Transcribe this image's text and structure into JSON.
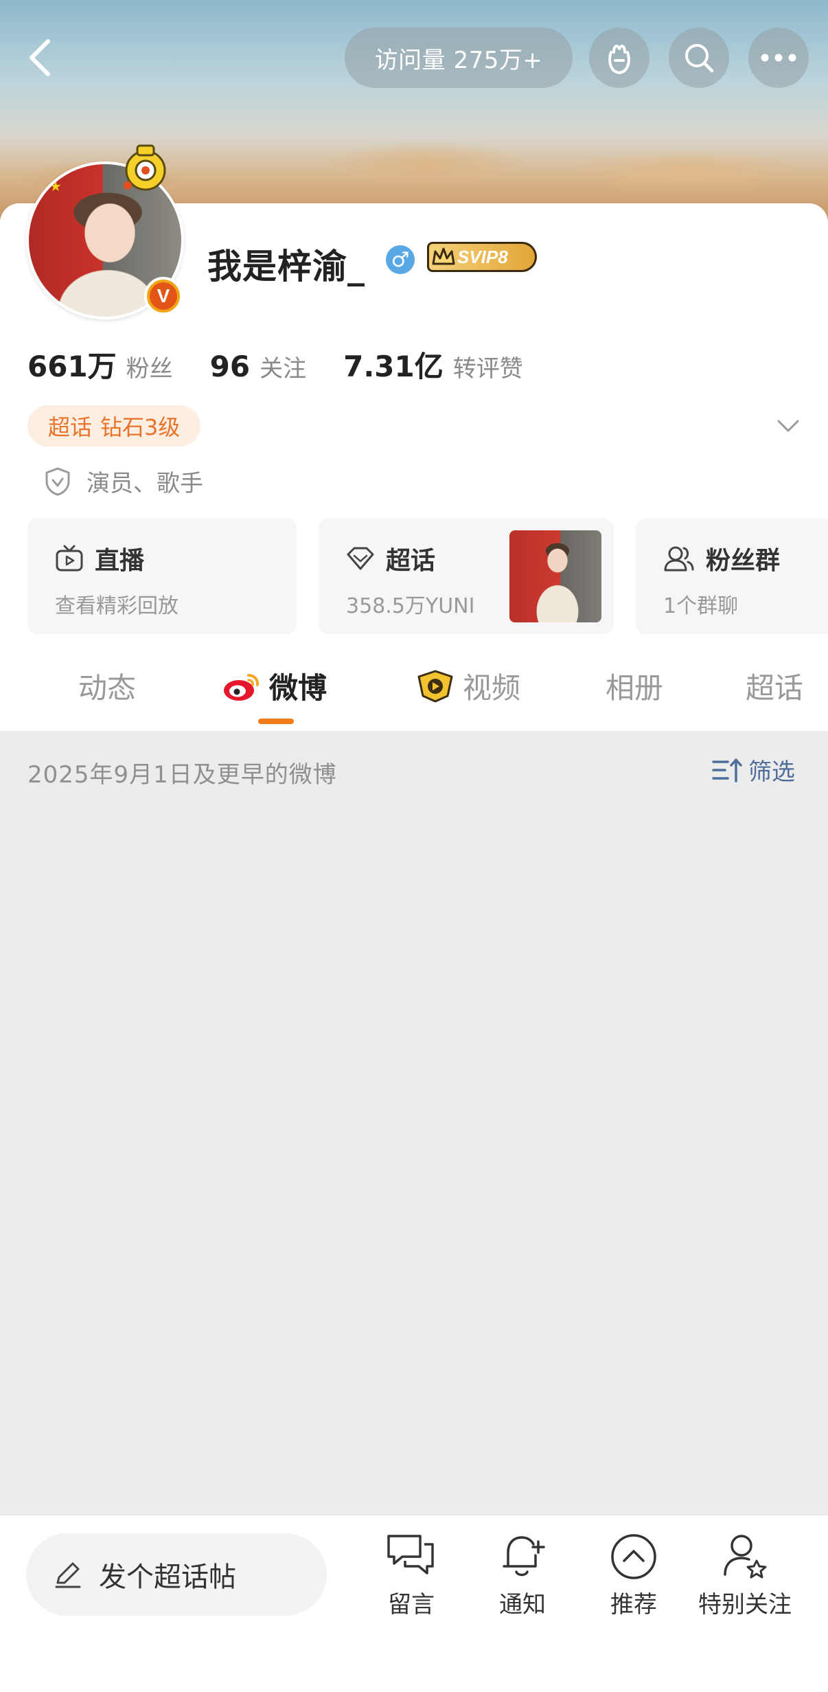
{
  "header": {
    "visits_label": "访问量 275万+"
  },
  "profile": {
    "name": "我是梓渝_",
    "gender_symbol": "♂",
    "vip_badge": "SVIP8",
    "verified_mark": "V",
    "stats": [
      {
        "value": "661万",
        "label": "粉丝"
      },
      {
        "value": "96",
        "label": "关注"
      },
      {
        "value": "7.31亿",
        "label": "转评赞"
      }
    ],
    "level_tag": {
      "part1": "超话",
      "part2": "钻石3级"
    },
    "role": "演员、歌手"
  },
  "tiles": {
    "live": {
      "title": "直播",
      "subtitle": "查看精彩回放"
    },
    "topic": {
      "title": "超话",
      "subtitle": "358.5万YUNI"
    },
    "fans": {
      "title": "粉丝群",
      "subtitle": "1个群聊"
    }
  },
  "tabs": [
    "动态",
    "微博",
    "视频",
    "相册",
    "超话"
  ],
  "active_tab": "微博",
  "feed": {
    "date_label": "2025年9月1日及更早的微博",
    "filter_label": "筛选"
  },
  "bottom_bar": {
    "compose_label": "发个超话帖",
    "items": [
      "留言",
      "通知",
      "推荐",
      "特别关注"
    ]
  },
  "colors": {
    "accent": "#f17a1b",
    "level_text": "#e8742b",
    "level_bg": "#fdeee2",
    "filter": "#4f6d99",
    "gender": "#5aa7e6"
  },
  "icons": [
    "back-icon",
    "gift-icon",
    "search-icon",
    "more-icon",
    "tv-icon",
    "diamond-icon",
    "group-icon",
    "weibo-icon",
    "video-icon",
    "shield-icon",
    "chevron-down-icon",
    "filter-icon",
    "pencil-icon",
    "chat-icon",
    "bell-icon",
    "up-circle-icon",
    "user-star-icon"
  ]
}
